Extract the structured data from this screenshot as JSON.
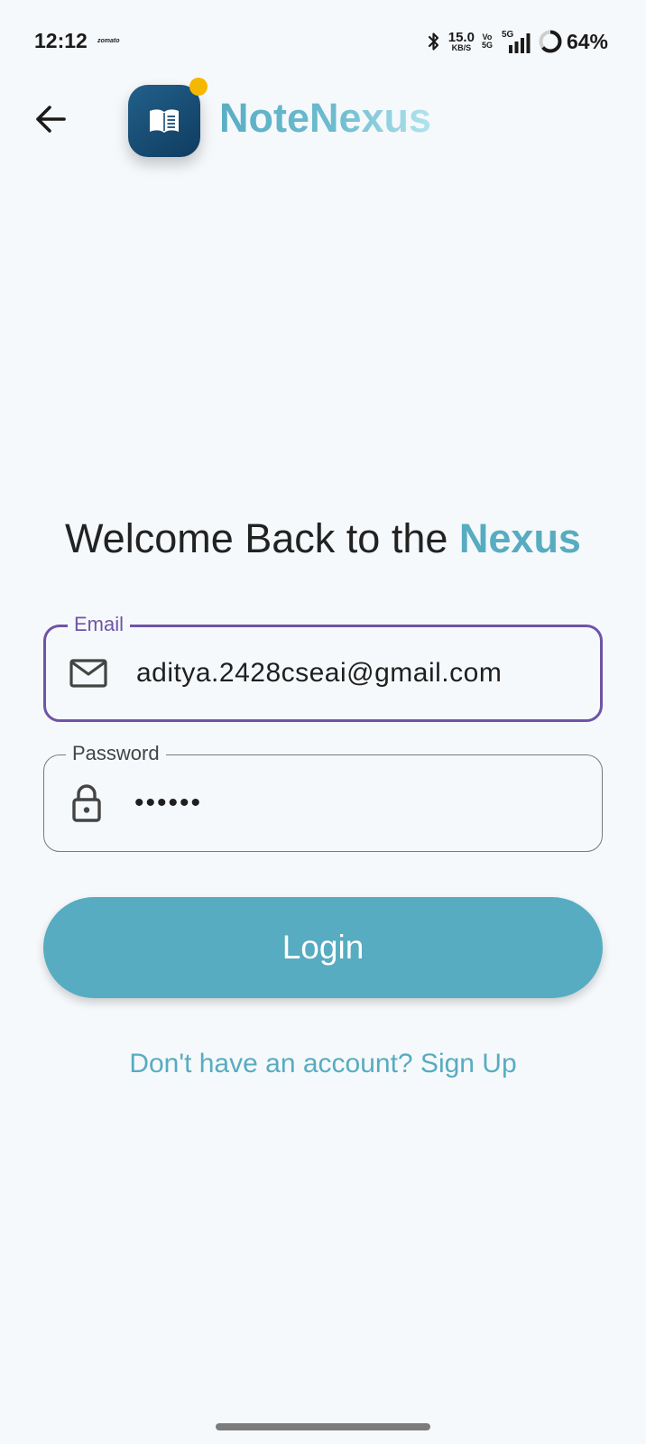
{
  "status_bar": {
    "time": "12:12",
    "notification_app": "zomato",
    "net_speed_value": "15.0",
    "net_speed_unit": "KB/S",
    "volte_top": "Vo",
    "volte_bottom": "5G",
    "network_type": "5G",
    "battery_percent": "64%",
    "battery_level": 0.64
  },
  "header": {
    "back_icon": "arrow-left-icon",
    "logo_icon": "open-book-icon",
    "app_title": "NoteNexus"
  },
  "welcome": {
    "prefix": "Welcome Back to the ",
    "accent": "Nexus"
  },
  "email": {
    "label": "Email",
    "value": "aditya.2428cseai@gmail.com",
    "icon": "mail-icon"
  },
  "password": {
    "label": "Password",
    "value": "••••••",
    "icon": "lock-icon"
  },
  "login_button": {
    "label": "Login"
  },
  "signup": {
    "text": "Don't have an account? Sign Up"
  },
  "colors": {
    "accent": "#57acc1",
    "focus": "#6e54a8",
    "logo_bg": "#1a4f77",
    "notification_dot": "#f5b800",
    "background": "#f6f9fb"
  }
}
